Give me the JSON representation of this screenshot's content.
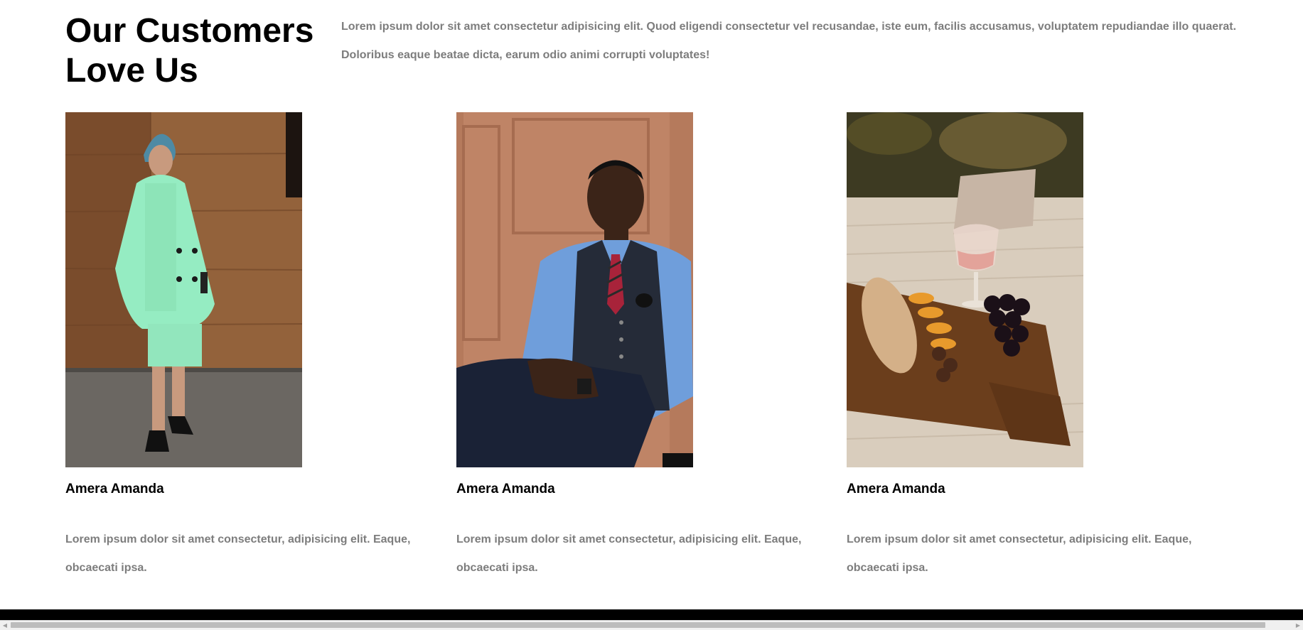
{
  "hero": {
    "title": "Our Customers Love Us",
    "description": "Lorem ipsum dolor sit amet consectetur adipisicing elit. Quod eligendi consectetur vel recusandae, iste eum, facilis accusamus, voluptatem repudiandae illo quaerat. Doloribus eaque beatae dicta, earum odio animi corrupti voluptates!"
  },
  "testimonials": [
    {
      "name": "Amera Amanda",
      "text": "Lorem ipsum dolor sit amet consectetur, adipisicing elit. Eaque, obcaecati ipsa."
    },
    {
      "name": "Amera Amanda",
      "text": "Lorem ipsum dolor sit amet consectetur, adipisicing elit. Eaque, obcaecati ipsa."
    },
    {
      "name": "Amera Amanda",
      "text": "Lorem ipsum dolor sit amet consectetur, adipisicing elit. Eaque, obcaecati ipsa."
    }
  ],
  "scrollbar": {
    "left_icon": "scroll-left-arrow-icon",
    "right_icon": "scroll-right-arrow-icon"
  }
}
